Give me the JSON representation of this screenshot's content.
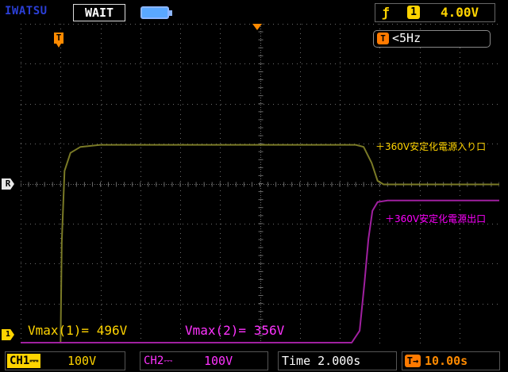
{
  "header": {
    "brand": "IWATSU",
    "run_state": "WAIT",
    "battery_icon": "battery-icon",
    "trigger": {
      "edge_icon": "rising-edge-icon",
      "edge_glyph": "ƒ",
      "source_channel": "1",
      "level": "4.00V"
    }
  },
  "screen": {
    "trigger_freq": "<5Hz",
    "trigger_freq_icon": "T",
    "markers": {
      "trigger_pos": "T",
      "reference": "R",
      "ch1_ground": "1"
    },
    "annotations": {
      "input_label": "＋360V安定化電源入り口",
      "output_label": "＋360V安定化電源出口"
    },
    "measurements": {
      "ch1": "Vmax(1)= 496V",
      "ch2": "Vmax(2)= 356V"
    }
  },
  "footer": {
    "ch1": {
      "label": "CH1",
      "coupling": "⎓",
      "scale": "100V"
    },
    "ch2": {
      "label": "CH2",
      "coupling": "⎓",
      "scale": "100V"
    },
    "timebase": "Time 2.000s",
    "delay": "10.00s",
    "delay_icon": "T→"
  },
  "colors": {
    "ch1": "#ffd400",
    "ch1_trace": "#7a7a26",
    "ch2": "#ff33ff",
    "ch2_trace": "#a020a0",
    "grid": "#6b6b6b",
    "marker": "#ff8a00"
  },
  "chart_data": {
    "type": "line",
    "x_divisions": 12,
    "y_divisions": 8,
    "series": [
      {
        "name": "＋360V安定化電源入り口",
        "channel": "CH1",
        "x_div": [
          0,
          1.0,
          1.03,
          1.1,
          1.25,
          1.5,
          2.0,
          4.0,
          7.0,
          8.4,
          8.6,
          8.8,
          8.95,
          9.1,
          12.0
        ],
        "y_div": [
          0,
          0,
          2.5,
          4.3,
          4.75,
          4.9,
          4.95,
          4.95,
          4.95,
          4.95,
          4.9,
          4.5,
          4.05,
          3.96,
          3.96
        ]
      },
      {
        "name": "＋360V安定化電源出口",
        "channel": "CH2",
        "x_div": [
          0,
          8.3,
          8.5,
          8.62,
          8.72,
          8.82,
          8.95,
          9.2,
          12.0
        ],
        "y_div": [
          0,
          0,
          0.3,
          1.5,
          2.6,
          3.3,
          3.52,
          3.56,
          3.56
        ]
      }
    ]
  }
}
